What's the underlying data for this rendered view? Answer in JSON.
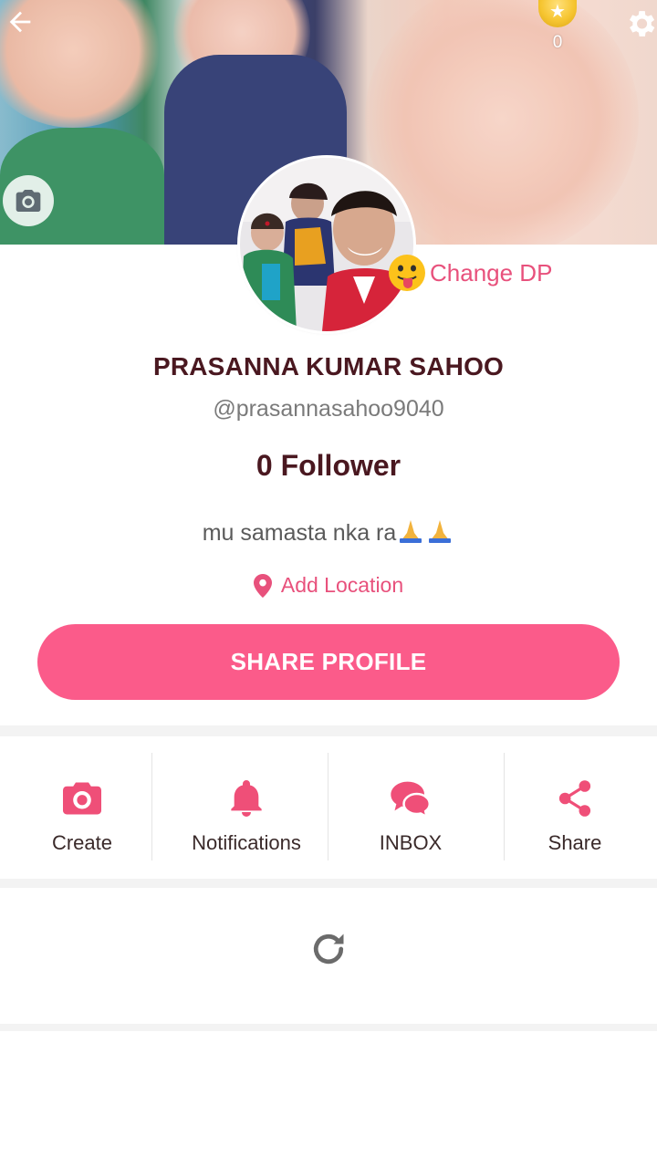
{
  "header": {
    "back_icon": "arrow-left-icon",
    "settings_icon": "gear-icon",
    "coins": {
      "icon": "gold-coin-icon",
      "count": "0"
    },
    "cover_camera_icon": "camera-icon"
  },
  "profile": {
    "change_dp_label": "Change DP",
    "change_dp_emoji": "tongue-out-emoji",
    "name": "PRASANNA KUMAR SAHOO",
    "handle": "@prasannasahoo9040",
    "followers": "0 Follower",
    "bio": "mu samasta nka ra",
    "bio_emoji": "folded-hands-emoji",
    "location_label": "Add Location"
  },
  "share_button": "SHARE PROFILE",
  "actions": [
    {
      "label": "Create",
      "icon": "camera-icon"
    },
    {
      "label": "Notifications",
      "icon": "bell-icon"
    },
    {
      "label": "INBOX",
      "icon": "chat-bubbles-icon"
    },
    {
      "label": "Share",
      "icon": "share-icon"
    }
  ],
  "feed": {
    "refresh_icon": "refresh-icon"
  },
  "colors": {
    "accent": "#fb5b8a",
    "accent_text": "#e8517c",
    "name_text": "#4a1820",
    "divider": "#f3f3f3"
  }
}
